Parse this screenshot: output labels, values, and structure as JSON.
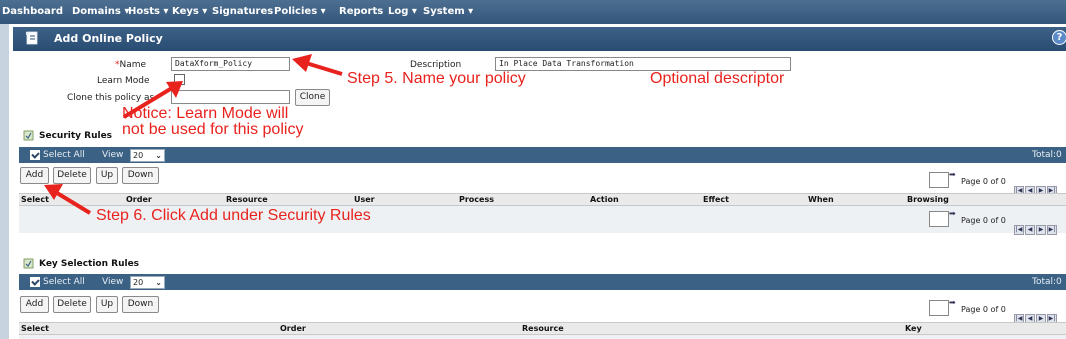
{
  "nav": {
    "items": [
      "Dashboard",
      "Domains ▾",
      "Hosts ▾",
      "Keys ▾",
      "Signatures",
      "Policies ▾",
      "Reports",
      "Log ▾",
      "System ▾"
    ]
  },
  "page": {
    "title": "Add Online Policy",
    "help": "?"
  },
  "form": {
    "name_required_mark": "*",
    "name_label": "Name",
    "name_value": "DataXform_Policy",
    "learn_mode_label": "Learn Mode",
    "clone_label": "Clone this policy as",
    "clone_value": "",
    "clone_button": "Clone",
    "description_label": "Description",
    "description_value": "In Place Data Transformation"
  },
  "annotations": {
    "step5": "Step 5. Name your policy",
    "optional": "Optional descriptor",
    "notice_line1": "Notice: Learn Mode will",
    "notice_line2": "not be used for this policy",
    "step6": "Step 6. Click Add under Security Rules"
  },
  "security_rules": {
    "title": "Security Rules",
    "select_all": "Select All",
    "view_label": "View",
    "view_value": "20",
    "total": "Total:0",
    "buttons": [
      "Add",
      "Delete",
      "Up",
      "Down"
    ],
    "columns": [
      "Select",
      "Order",
      "Resource",
      "User",
      "Process",
      "Action",
      "Effect",
      "When",
      "Browsing"
    ],
    "page_info": "Page 0 of 0"
  },
  "key_selection_rules": {
    "title": "Key Selection Rules",
    "select_all": "Select All",
    "view_label": "View",
    "view_value": "20",
    "total": "Total:0",
    "buttons": [
      "Add",
      "Delete",
      "Up",
      "Down"
    ],
    "columns": [
      "Select",
      "Order",
      "Resource",
      "Key"
    ],
    "page_info": "Page 0 of 0"
  },
  "colors": {
    "nav_bg": "#3f6289",
    "accent_red": "#e8231e",
    "table_bar": "#3b6285"
  }
}
